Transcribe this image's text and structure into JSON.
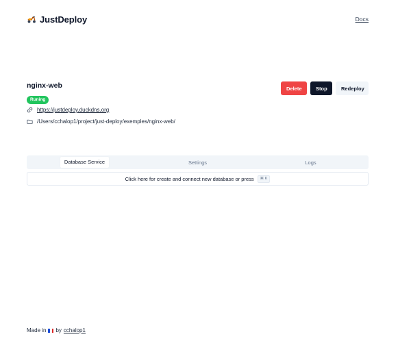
{
  "header": {
    "brand_name": "JustDeploy",
    "logo_icon": "scooter-icon",
    "docs_label": "Docs"
  },
  "service": {
    "name": "nginx-web",
    "status": "Runing",
    "url": "https://justdeploy.duckdns.org",
    "path": "/Users/cchalop1/project/just-deploy/exemples/nginx-web/",
    "url_icon": "link-icon",
    "path_icon": "folder-icon"
  },
  "actions": {
    "delete_label": "Delete",
    "stop_label": "Stop",
    "redeploy_label": "Redeploy"
  },
  "tabs": [
    {
      "label": "Database Service",
      "active": true
    },
    {
      "label": "Settings",
      "active": false
    },
    {
      "label": "Logs",
      "active": false
    }
  ],
  "command_bar": {
    "text": "Click here for create and connect new database or press",
    "shortcut": "⌘ K"
  },
  "footer": {
    "made_in": "Made in",
    "flag_icon": "france-flag-icon",
    "by": "by",
    "author": "cchalop1"
  },
  "colors": {
    "status_green": "#22c55e",
    "delete_red": "#ef4444",
    "stop_dark": "#0f172a",
    "muted_bg": "#f1f5f9"
  }
}
